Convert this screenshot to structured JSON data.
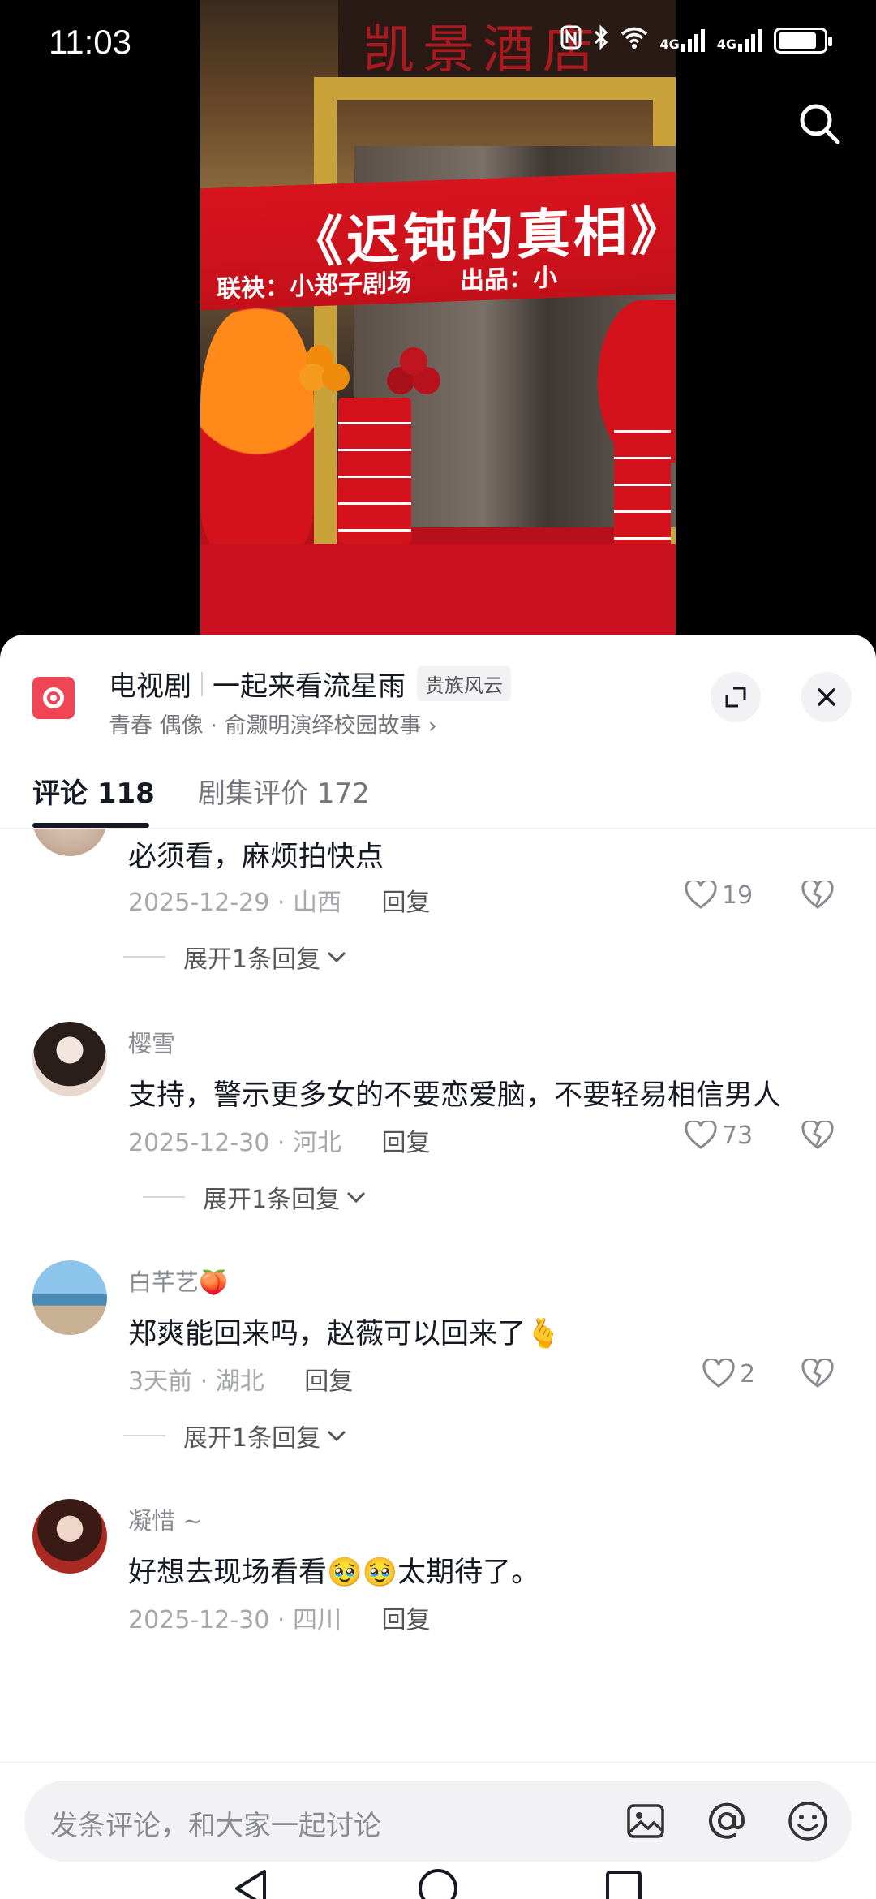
{
  "statusbar": {
    "time": "11:03",
    "network_1": "4G",
    "network_2": "4G",
    "battery_level": 0.85
  },
  "video": {
    "banner_title": "《迟钝的真相》",
    "banner_sub": "联袂：小郑子剧场　　出品：小"
  },
  "sheet": {
    "category": "电视剧",
    "title": "一起来看流星雨",
    "tag": "贵族风云",
    "subtitle": "青春 偶像 · 俞灏明演绎校园故事",
    "subtitle_arrow": "›"
  },
  "tabs": [
    {
      "label": "评论 118"
    },
    {
      "label": "剧集评价 172"
    }
  ],
  "comments": [
    {
      "user": "",
      "text": "必须看，麻烦拍快点",
      "date": "2025-12-29",
      "region": "山西",
      "reply": "回复",
      "likes": "19",
      "expand": "展开1条回复"
    },
    {
      "user": "樱雪",
      "text": "支持，警示更多女的不要恋爱脑，不要轻易相信男人",
      "date": "2025-12-30",
      "region": "河北",
      "reply": "回复",
      "likes": "73",
      "expand": "展开1条回复"
    },
    {
      "user": "白芊艺",
      "user_emoji": "🍑",
      "text": "郑爽能回来吗，赵薇可以回来了",
      "text_emoji": "🫰",
      "date": "3天前",
      "region": "湖北",
      "reply": "回复",
      "likes": "2",
      "expand": "展开1条回复"
    },
    {
      "user": "凝惜 ~",
      "text": "好想去现场看看🥹🥹太期待了。",
      "date": "2025-12-30",
      "region": "四川",
      "reply": "回复"
    }
  ],
  "input": {
    "placeholder": "发条评论，和大家一起讨论"
  },
  "meta_sep": " · ",
  "icons": {
    "search": "search-icon",
    "expand": "expand-icon",
    "close": "close-icon",
    "heart": "heart-icon",
    "dislike": "broken-heart-icon",
    "image": "image-icon",
    "at": "at-icon",
    "emoji": "emoji-icon"
  },
  "colors": {
    "accent": "#ef4554",
    "text_primary": "#161823",
    "text_secondary": "#8a8b91"
  }
}
